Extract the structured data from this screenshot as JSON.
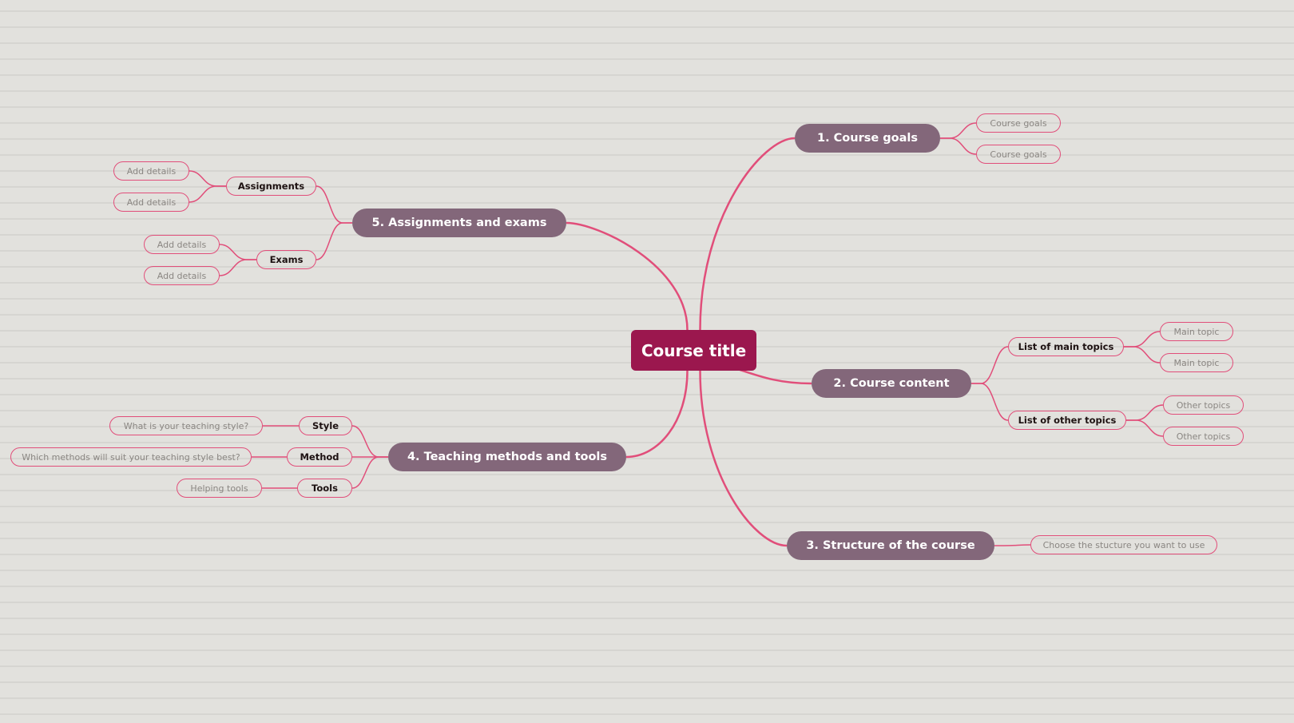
{
  "mindmap": {
    "root": {
      "label": "Course title",
      "color": "#9b174e"
    },
    "branch_color": "#e14e7a",
    "main_node_color": "#83677a",
    "branches": [
      {
        "label": "1. Course goals",
        "children": [
          {
            "label": "Course goals"
          },
          {
            "label": "Course goals"
          }
        ]
      },
      {
        "label": "2. Course content",
        "children": [
          {
            "label": "List of main topics",
            "children": [
              {
                "label": "Main topic"
              },
              {
                "label": "Main topic"
              }
            ]
          },
          {
            "label": "List of other topics",
            "children": [
              {
                "label": "Other topics"
              },
              {
                "label": "Other topics"
              }
            ]
          }
        ]
      },
      {
        "label": "3. Structure of the course",
        "children": [
          {
            "label": "Choose the stucture you want to use"
          }
        ]
      },
      {
        "label": "4. Teaching methods and tools",
        "children": [
          {
            "label": "Style",
            "children": [
              {
                "label": "What is your teaching style?"
              }
            ]
          },
          {
            "label": "Method",
            "children": [
              {
                "label": "Which methods will suit your teaching style best?"
              }
            ]
          },
          {
            "label": "Tools",
            "children": [
              {
                "label": "Helping tools"
              }
            ]
          }
        ]
      },
      {
        "label": "5. Assignments and exams",
        "children": [
          {
            "label": "Assignments",
            "children": [
              {
                "label": "Add details"
              },
              {
                "label": "Add details"
              }
            ]
          },
          {
            "label": "Exams",
            "children": [
              {
                "label": "Add details"
              },
              {
                "label": "Add details"
              }
            ]
          }
        ]
      }
    ]
  }
}
